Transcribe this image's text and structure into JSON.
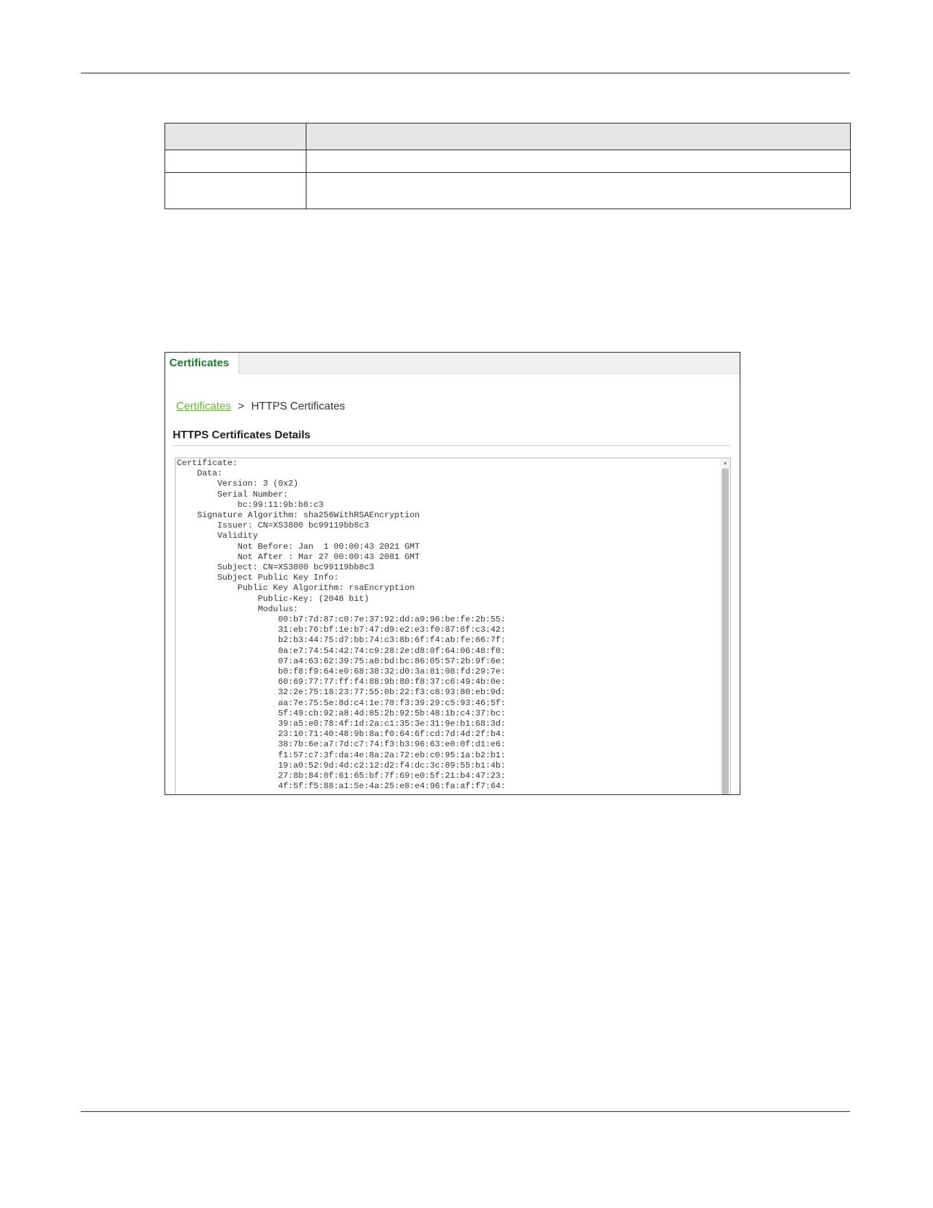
{
  "tab": {
    "label": "Certificates"
  },
  "breadcrumb": {
    "link": "Certificates",
    "separator": ">",
    "current": "HTTPS Certificates"
  },
  "section": {
    "title": "HTTPS Certificates Details"
  },
  "certificate_text": [
    "Certificate:",
    "    Data:",
    "        Version: 3 (0x2)",
    "        Serial Number:",
    "            bc:99:11:9b:b8:c3",
    "    Signature Algorithm: sha256WithRSAEncryption",
    "        Issuer: CN=XS3800 bc99119bb8c3",
    "        Validity",
    "            Not Before: Jan  1 00:00:43 2021 GMT",
    "            Not After : Mar 27 00:00:43 2081 GMT",
    "        Subject: CN=XS3800 bc99119bb8c3",
    "        Subject Public Key Info:",
    "            Public Key Algorithm: rsaEncryption",
    "                Public-Key: (2048 bit)",
    "                Modulus:",
    "                    00:b7:7d:87:c0:7e:37:92:dd:a9:96:be:fe:2b:55:",
    "                    31:eb:76:bf:1e:b7:47:d9:e2:e3:f0:87:6f:c3:42:",
    "                    b2:b3:44:75:d7:bb:74:c3:8b:6f:f4:ab:fe:66:7f:",
    "                    0a:e7:74:54:42:74:c9:28:2e:d8:0f:64:06:48:f0:",
    "                    07:a4:63:62:39:75:a0:bd:bc:86:05:57:2b:9f:6e:",
    "                    b0:f8:f9:64:e0:68:38:32:d0:3a:81:08:fd:29:7e:",
    "                    60:69:77:77:ff:f4:88:9b:80:f8:37:c6:49:4b:0e:",
    "                    32:2e:75:18:23:77:55:0b:22:f3:c8:93:80:eb:9d:",
    "                    aa:7e:75:5e:8d:c4:1e:78:f3:39:29:c5:93:46:5f:",
    "                    5f:49:cb:92:a8:4d:85:2b:92:5b:48:1b:c4:37:bc:",
    "                    39:a5:e0:78:4f:1d:2a:c1:35:3e:31:9e:b1:68:3d:",
    "                    23:10:71:40:48:9b:8a:f0:64:6f:cd:7d:4d:2f:b4:",
    "                    38:7b:6e:a7:7d:c7:74:f3:b3:96:63:e0:0f:d1:e6:",
    "                    f1:57:c7:3f:da:4e:8a:2a:72:eb:c0:95:1a:b2:b1:",
    "                    19:a0:52:9d:4d:c2:12:d2:f4:dc:3c:89:55:b1:4b:",
    "                    27:8b:84:0f:61:65:bf:7f:69:e0:5f:21:b4:47:23:",
    "                    4f:5f:f5:88:a1:5e:4a:25:e8:e4:96:fa:af:f7:64:"
  ],
  "colors": {
    "tab_text": "#1e7d2a",
    "link": "#6ab43a"
  }
}
